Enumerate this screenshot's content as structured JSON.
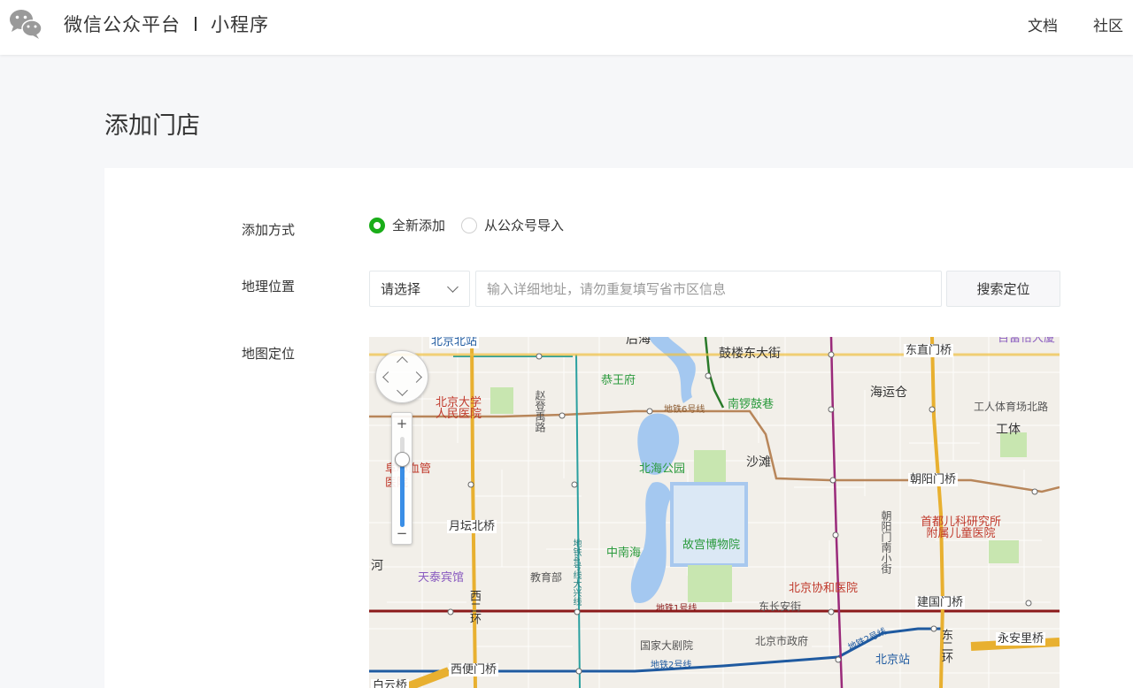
{
  "header": {
    "logo_icon": "wechat-icon",
    "brand": "微信公众平台",
    "product": "小程序",
    "nav": [
      "文档",
      "社区"
    ]
  },
  "page_title": "添加门店",
  "form": {
    "method_label": "添加方式",
    "method_options": [
      {
        "label": "全新添加",
        "selected": true
      },
      {
        "label": "从公众号导入",
        "selected": false
      }
    ],
    "location_label": "地理位置",
    "region_select_value": "请选择",
    "address_placeholder": "输入详细地址，请勿重复填写省市区信息",
    "address_value": "",
    "search_button": "搜索定位",
    "map_label": "地图定位"
  },
  "map": {
    "zoom_in": "+",
    "zoom_out": "−",
    "zoom_level_fraction": 0.75,
    "labels": {
      "beijing_north": "北京北站",
      "houhai": "后海",
      "gulou": "鼓楼东大街",
      "dongzhimen": "东直门桥",
      "xinshibao": "百富怡大厦",
      "gongwangfu": "恭王府",
      "nanluoguxiang": "南锣鼓巷",
      "haiyuncang": "海运仓",
      "pku_hospital": "北京大学\n人民医院",
      "zhaodengyu": "赵登禹路",
      "metro6": "地铁6号线",
      "gongti_north": "工人体育场北路",
      "gongti": "工体",
      "beihai": "北海公园",
      "shatan": "沙滩",
      "fuxin_hospital": "阜心血管医院",
      "chaoyangmen": "朝阳门桥",
      "yuetan": "月坛北桥",
      "gugong": "故宫博物院",
      "chaoyangmen_s": "朝阳门南小街",
      "capital_children": "首都儿科研究所\n附属儿童医院",
      "he": "河",
      "tiantai": "天泰宾馆",
      "jiaoyubu": "教育部",
      "zhongnanhai": "中南海",
      "metro4": "地铁4号线大兴线",
      "pumc": "北京协和医院",
      "xierhuan": "西二环",
      "jianguomen": "建国门桥",
      "metro1": "地铁1号线",
      "dongchangan": "东长安街",
      "ncpa": "国家大剧院",
      "city_gov": "北京市政府",
      "metro2_east": "地铁2号线",
      "beijing_station": "北京站",
      "dongerhuan": "东二环",
      "yonganli": "永安里桥",
      "xibianmen": "西便门桥",
      "metro2": "地铁2号线",
      "baiyun": "白云桥"
    }
  }
}
